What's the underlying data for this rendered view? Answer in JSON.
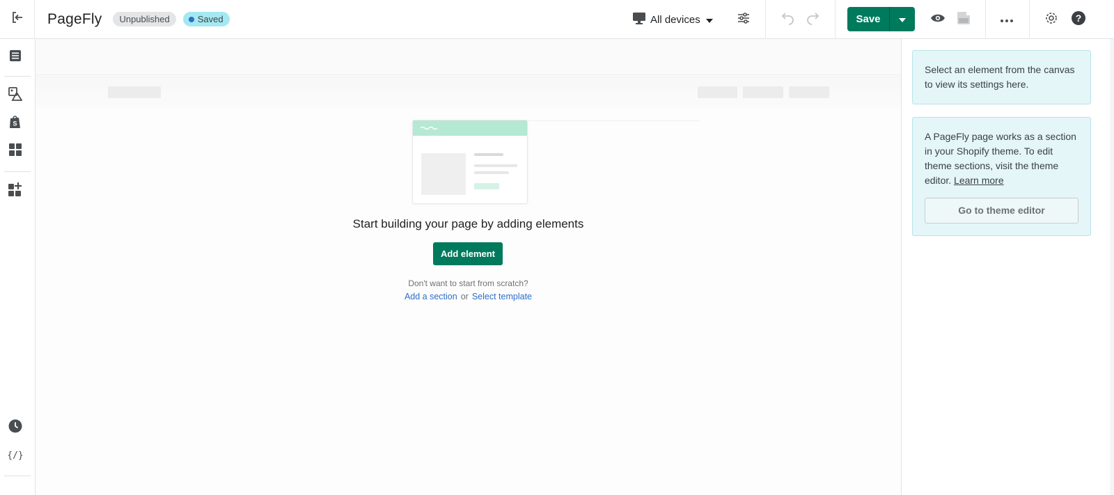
{
  "app": {
    "title": "PageFly",
    "status_unpublished": "Unpublished",
    "status_saved": "Saved"
  },
  "toolbar": {
    "device_label": "All devices",
    "save_label": "Save"
  },
  "icons": {
    "exit": "exit-icon",
    "page_outline": "list-icon",
    "media": "image-shapes-icon",
    "shopify": "shopify-bag-icon",
    "sections": "grid-icon",
    "add_element": "add-grid-icon",
    "history": "clock-icon",
    "code": "code-icon",
    "monitor": "monitor-icon",
    "settings_sliders": "sliders-icon",
    "undo": "undo-icon",
    "redo": "redo-icon",
    "preview": "eye-icon",
    "publish_preview": "page-preview-icon",
    "more": "more-icon",
    "gear": "gear-icon",
    "help": "help-icon"
  },
  "canvas": {
    "empty_title": "Start building your page by adding elements",
    "add_element_label": "Add element",
    "subtext": "Don't want to start from scratch?",
    "add_section_link": "Add a section",
    "or_text": "or",
    "select_template_link": "Select template"
  },
  "panel": {
    "card1_text": "Select an element from the canvas to view its settings here.",
    "card2_text": "A PageFly page works as a section in your Shopify theme. To edit theme sections, visit the theme editor.",
    "card2_link": "Learn more",
    "theme_editor_label": "Go to theme editor"
  },
  "colors": {
    "primary": "#007a5c",
    "link": "#2c6ecb",
    "info_bg": "#e4f6f8",
    "saved_badge": "#a4e8f2"
  }
}
